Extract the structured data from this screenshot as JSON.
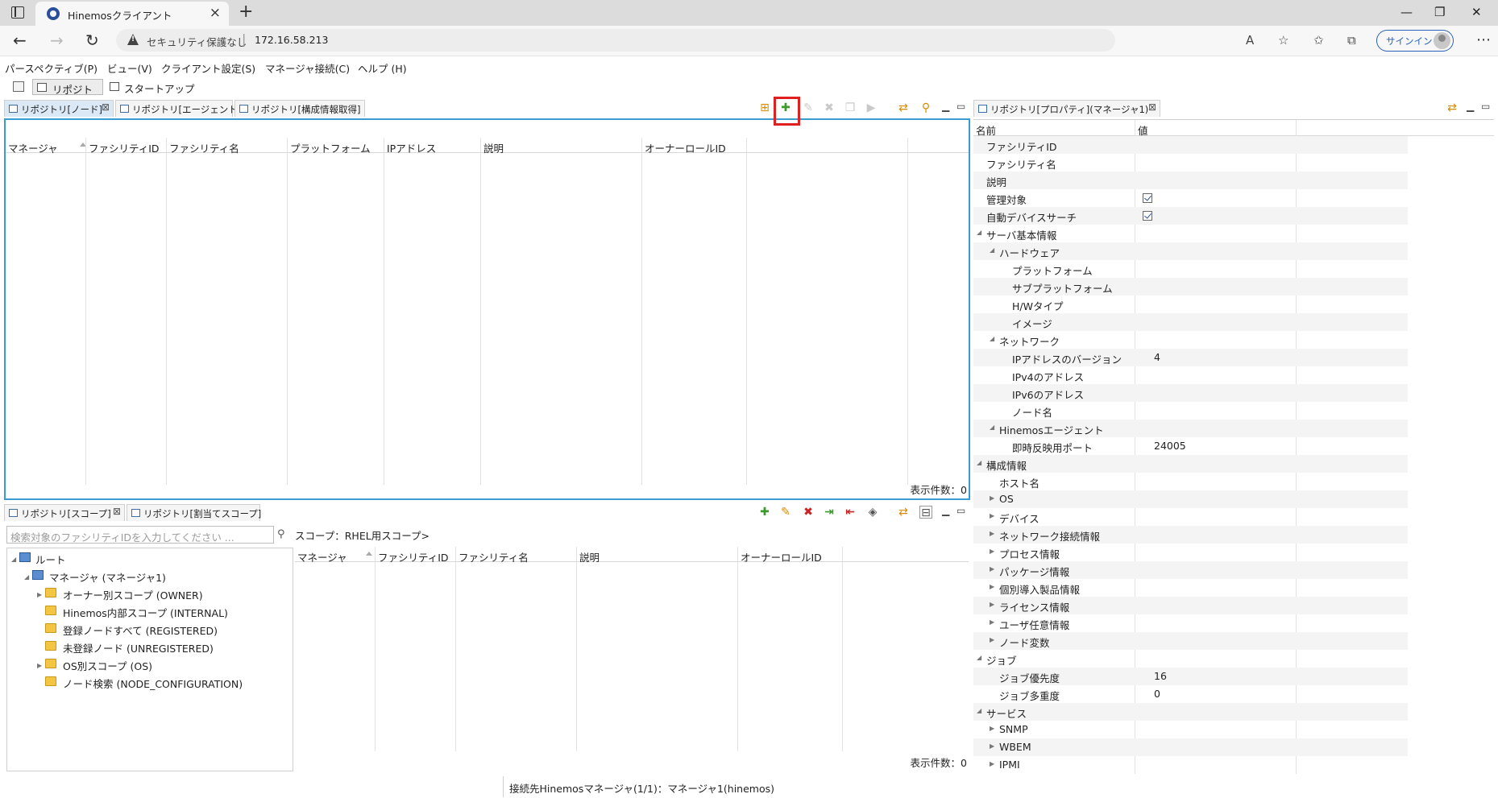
{
  "browser": {
    "tab_title": "Hinemosクライアント",
    "security_label": "セキュリティ保護なし",
    "url": "172.16.58.213",
    "signin_label": "サインイン"
  },
  "menubar": {
    "items": [
      "パースペクティブ(P)",
      "ビュー(V)",
      "クライアント設定(S)",
      "マネージャ接続(C)",
      "ヘルプ (H)"
    ]
  },
  "perspectives": {
    "repository": "リポジトリ",
    "startup": "スタートアップ"
  },
  "node_panel": {
    "tabs": [
      "リポジトリ[ノード]",
      "リポジトリ[エージェント]",
      "リポジトリ[構成情報取得]"
    ],
    "columns": [
      "マネージャ",
      "ファシリティID",
      "ファシリティ名",
      "プラットフォーム",
      "IPアドレス",
      "説明",
      "オーナーロールID"
    ],
    "count_label": "表示件数：0"
  },
  "scope_panel": {
    "tabs": [
      "リポジトリ[スコープ]",
      "リポジトリ[割当てスコープ]"
    ],
    "search_placeholder": "検索対象のファシリティIDを入力してください ...",
    "scope_label": "スコープ：RHEL用スコープ>",
    "columns": [
      "マネージャ",
      "ファシリティID",
      "ファシリティ名",
      "説明",
      "オーナーロールID"
    ],
    "count_label": "表示件数：0",
    "tree": [
      "ルート",
      "マネージャ (マネージャ1)",
      "オーナー別スコープ (OWNER)",
      "Hinemos内部スコープ (INTERNAL)",
      "登録ノードすべて (REGISTERED)",
      "未登録ノード (UNREGISTERED)",
      "OS別スコープ (OS)",
      "ノード検索 (NODE_CONFIGURATION)"
    ]
  },
  "property_panel": {
    "tab": "リポジトリ[プロパティ](マネージャ1)",
    "col_name": "名前",
    "col_value": "値",
    "rows": [
      {
        "name": "ファシリティID",
        "value": ""
      },
      {
        "name": "ファシリティ名",
        "value": ""
      },
      {
        "name": "説明",
        "value": ""
      },
      {
        "name": "管理対象",
        "value": ""
      },
      {
        "name": "自動デバイスサーチ",
        "value": ""
      },
      {
        "name": "サーバ基本情報",
        "value": ""
      },
      {
        "name": "ハードウェア",
        "value": ""
      },
      {
        "name": "プラットフォーム",
        "value": ""
      },
      {
        "name": "サブプラットフォーム",
        "value": ""
      },
      {
        "name": "H/Wタイプ",
        "value": ""
      },
      {
        "name": "イメージ",
        "value": ""
      },
      {
        "name": "ネットワーク",
        "value": ""
      },
      {
        "name": "IPアドレスのバージョン",
        "value": "4"
      },
      {
        "name": "IPv4のアドレス",
        "value": ""
      },
      {
        "name": "IPv6のアドレス",
        "value": ""
      },
      {
        "name": "ノード名",
        "value": ""
      },
      {
        "name": "Hinemosエージェント",
        "value": ""
      },
      {
        "name": "即時反映用ポート",
        "value": "24005"
      },
      {
        "name": "構成情報",
        "value": ""
      },
      {
        "name": "ホスト名",
        "value": ""
      },
      {
        "name": "OS",
        "value": ""
      },
      {
        "name": "デバイス",
        "value": ""
      },
      {
        "name": "ネットワーク接続情報",
        "value": ""
      },
      {
        "name": "プロセス情報",
        "value": ""
      },
      {
        "name": "パッケージ情報",
        "value": ""
      },
      {
        "name": "個別導入製品情報",
        "value": ""
      },
      {
        "name": "ライセンス情報",
        "value": ""
      },
      {
        "name": "ユーザ任意情報",
        "value": ""
      },
      {
        "name": "ノード変数",
        "value": ""
      },
      {
        "name": "ジョブ",
        "value": ""
      },
      {
        "name": "ジョブ優先度",
        "value": "16"
      },
      {
        "name": "ジョブ多重度",
        "value": "0"
      },
      {
        "name": "サービス",
        "value": ""
      },
      {
        "name": "SNMP",
        "value": ""
      },
      {
        "name": "WBEM",
        "value": ""
      },
      {
        "name": "IPMI",
        "value": ""
      }
    ]
  },
  "status": {
    "text": "接続先Hinemosマネージャ(1/1)：マネージャ1(hinemos)"
  }
}
